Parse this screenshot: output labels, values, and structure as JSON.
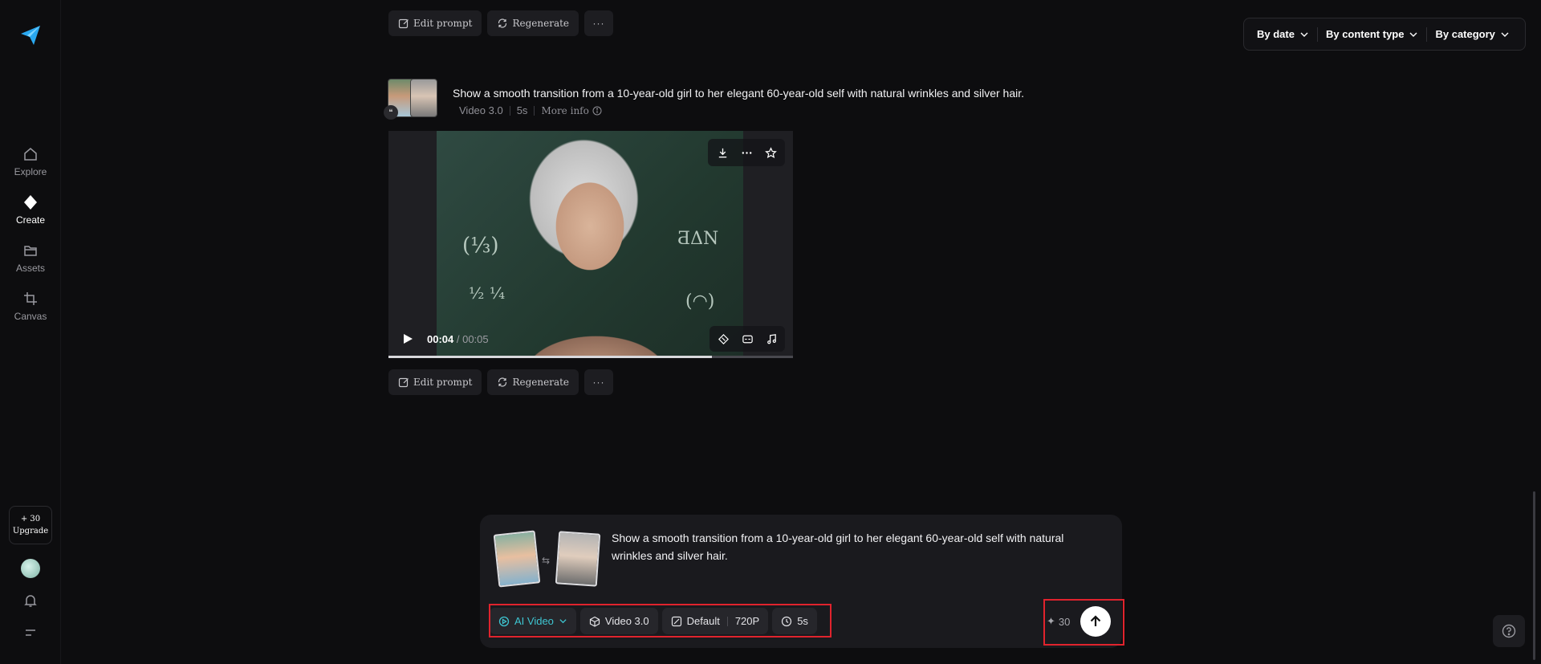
{
  "sidebar": {
    "logo": "paper-plane-logo",
    "items": [
      {
        "label": "Explore",
        "icon": "home-icon"
      },
      {
        "label": "Create",
        "icon": "diamond-icon"
      },
      {
        "label": "Assets",
        "icon": "folder-icon"
      },
      {
        "label": "Canvas",
        "icon": "crop-icon"
      }
    ],
    "credits": "+ 30",
    "upgrade_label": "Upgrade"
  },
  "filters": {
    "by_date": "By date",
    "by_content_type": "By content type",
    "by_category": "By category"
  },
  "actions": {
    "edit_prompt": "Edit prompt",
    "regenerate": "Regenerate",
    "more": "···"
  },
  "generation": {
    "prompt": "Show a smooth transition from a 10-year-old girl to her elegant 60-year-old self with natural wrinkles and silver hair.",
    "model": "Video 3.0",
    "duration": "5s",
    "more_info": "More info",
    "quote_badge": "❝"
  },
  "video": {
    "current_time": "00:04",
    "total_time": "00:05",
    "progress": 0.8
  },
  "composer": {
    "prompt": "Show a smooth transition from a 10-year-old girl to her elegant 60-year-old self with natural wrinkles and silver hair.",
    "swap_glyph": "⇆",
    "mode": "AI Video",
    "model": "Video 3.0",
    "ratio": "Default",
    "resolution": "720P",
    "duration": "5s",
    "cost": "30",
    "cost_glyph": "✦"
  },
  "colors": {
    "accent": "#3ec6d2",
    "highlight": "#e0232d",
    "background": "#0d0d0f"
  }
}
